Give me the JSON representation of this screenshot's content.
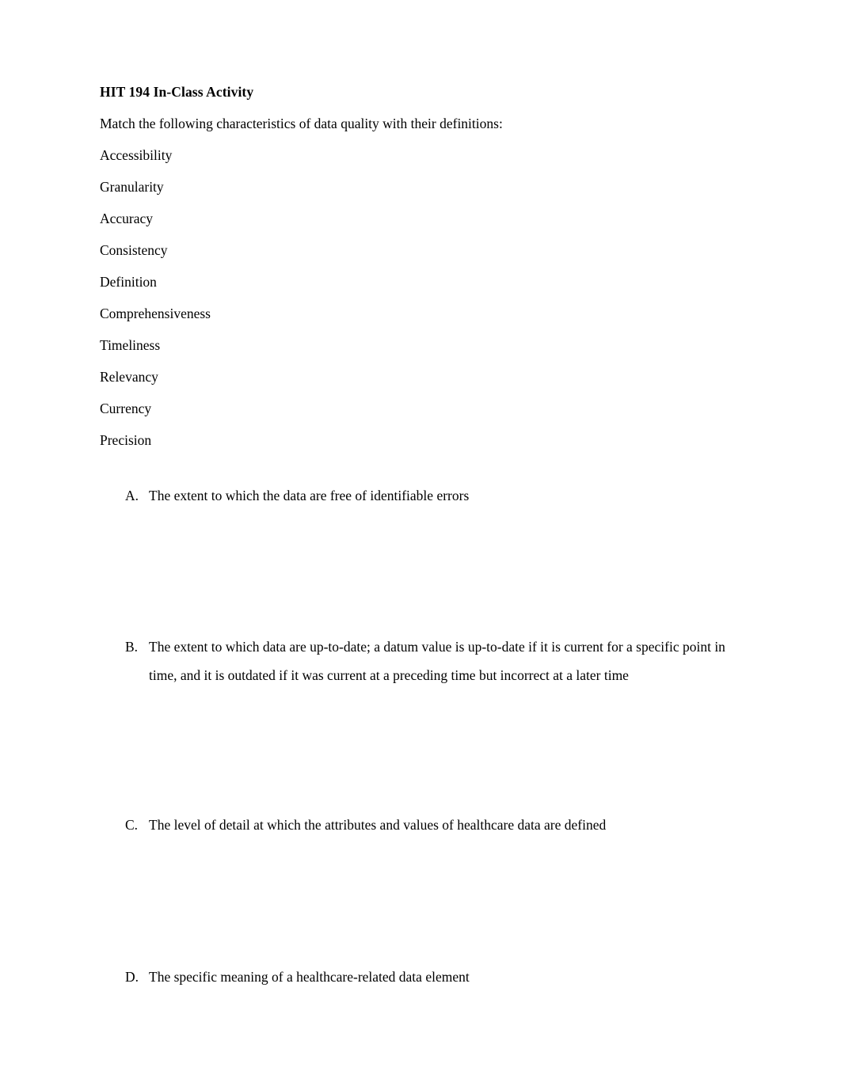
{
  "document": {
    "title": "HIT 194 In-Class Activity",
    "instruction": "Match the following characteristics of data quality with their definitions:",
    "terms": [
      {
        "label": "Accessibility"
      },
      {
        "label": "Granularity"
      },
      {
        "label": "Accuracy"
      },
      {
        "label": "Consistency"
      },
      {
        "label": "Definition"
      },
      {
        "label": "Comprehensiveness"
      },
      {
        "label": "Timeliness"
      },
      {
        "label": "Relevancy"
      },
      {
        "label": "Currency"
      },
      {
        "label": "Precision"
      }
    ],
    "definitions": [
      {
        "marker": "A.",
        "text": "The extent to which the data are free of identifiable errors"
      },
      {
        "marker": "B.",
        "text": "The extent to which data are up-to-date; a datum value is up-to-date if it is current for a specific point in time, and it is outdated if it was current at a preceding time but incorrect at a later time"
      },
      {
        "marker": "C.",
        "text": "The level of detail at which the attributes and values of healthcare data are defined"
      },
      {
        "marker": "D.",
        "text": "The specific meaning of a healthcare-related data element"
      }
    ]
  },
  "style": {
    "page_background": "#ffffff",
    "text_color": "#000000"
  }
}
